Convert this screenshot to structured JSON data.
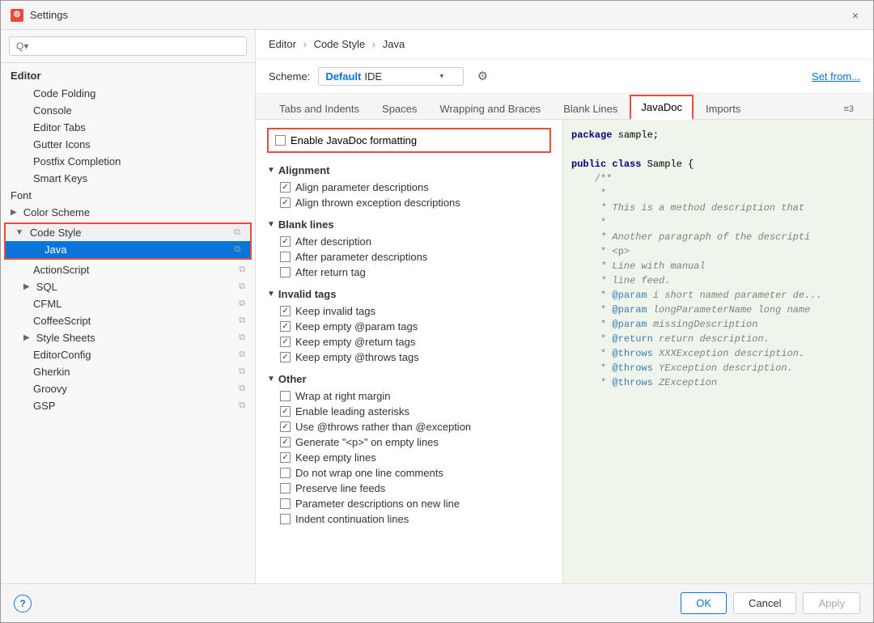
{
  "window": {
    "title": "Settings",
    "icon": "⚙",
    "close_label": "×"
  },
  "search": {
    "placeholder": "Q▾"
  },
  "sidebar": {
    "sections": [
      {
        "label": "Editor",
        "type": "section-header",
        "children": [
          {
            "label": "Code Folding",
            "indent": 1,
            "type": "item"
          },
          {
            "label": "Console",
            "indent": 1,
            "type": "item"
          },
          {
            "label": "Editor Tabs",
            "indent": 1,
            "type": "item"
          },
          {
            "label": "Gutter Icons",
            "indent": 1,
            "type": "item"
          },
          {
            "label": "Postfix Completion",
            "indent": 1,
            "type": "item"
          },
          {
            "label": "Smart Keys",
            "indent": 1,
            "type": "item"
          },
          {
            "label": "Font",
            "indent": 0,
            "type": "item"
          },
          {
            "label": "Color Scheme",
            "indent": 0,
            "type": "group-collapsed"
          },
          {
            "label": "Code Style",
            "indent": 0,
            "type": "group-expanded",
            "active": true
          },
          {
            "label": "Java",
            "indent": 1,
            "type": "item",
            "active": true
          },
          {
            "label": "ActionScript",
            "indent": 1,
            "type": "item"
          },
          {
            "label": "SQL",
            "indent": 1,
            "type": "group-collapsed"
          },
          {
            "label": "CFML",
            "indent": 1,
            "type": "item"
          },
          {
            "label": "CoffeeScript",
            "indent": 1,
            "type": "item"
          },
          {
            "label": "Style Sheets",
            "indent": 1,
            "type": "group-collapsed"
          },
          {
            "label": "EditorConfig",
            "indent": 1,
            "type": "item"
          },
          {
            "label": "Gherkin",
            "indent": 1,
            "type": "item"
          },
          {
            "label": "Groovy",
            "indent": 1,
            "type": "item"
          },
          {
            "label": "GSP",
            "indent": 1,
            "type": "item"
          }
        ]
      }
    ]
  },
  "breadcrumb": {
    "parts": [
      "Editor",
      "Code Style",
      "Java"
    ],
    "separator": "›"
  },
  "scheme": {
    "label": "Scheme:",
    "value_bold": "Default",
    "value_normal": "IDE",
    "set_from": "Set from..."
  },
  "tabs": {
    "items": [
      {
        "label": "Tabs and Indents",
        "active": false
      },
      {
        "label": "Spaces",
        "active": false
      },
      {
        "label": "Wrapping and Braces",
        "active": false
      },
      {
        "label": "Blank Lines",
        "active": false
      },
      {
        "label": "JavaDoc",
        "active": true,
        "highlighted": true
      },
      {
        "label": "Imports",
        "active": false
      }
    ],
    "more_label": "≡3"
  },
  "javadoc": {
    "enable_label": "Enable JavaDoc formatting",
    "enable_checked": false,
    "sections": [
      {
        "label": "Alignment",
        "expanded": true,
        "items": [
          {
            "label": "Align parameter descriptions",
            "checked": true
          },
          {
            "label": "Align thrown exception descriptions",
            "checked": true
          }
        ]
      },
      {
        "label": "Blank lines",
        "expanded": true,
        "items": [
          {
            "label": "After description",
            "checked": true
          },
          {
            "label": "After parameter descriptions",
            "checked": false
          },
          {
            "label": "After return tag",
            "checked": false
          }
        ]
      },
      {
        "label": "Invalid tags",
        "expanded": true,
        "items": [
          {
            "label": "Keep invalid tags",
            "checked": true
          },
          {
            "label": "Keep empty @param tags",
            "checked": true
          },
          {
            "label": "Keep empty @return tags",
            "checked": true
          },
          {
            "label": "Keep empty @throws tags",
            "checked": true
          }
        ]
      },
      {
        "label": "Other",
        "expanded": true,
        "items": [
          {
            "label": "Wrap at right margin",
            "checked": false
          },
          {
            "label": "Enable leading asterisks",
            "checked": true
          },
          {
            "label": "Use @throws rather than @exception",
            "checked": true
          },
          {
            "label": "Generate \"<p>\" on empty lines",
            "checked": true
          },
          {
            "label": "Keep empty lines",
            "checked": true
          },
          {
            "label": "Do not wrap one line comments",
            "checked": false
          },
          {
            "label": "Preserve line feeds",
            "checked": false
          },
          {
            "label": "Parameter descriptions on new line",
            "checked": false
          },
          {
            "label": "Indent continuation lines",
            "checked": false
          }
        ]
      }
    ]
  },
  "preview": {
    "lines": [
      {
        "type": "normal",
        "text": "package sample;"
      },
      {
        "type": "blank"
      },
      {
        "type": "keyword",
        "text": "public class ",
        "rest": "Sample {"
      },
      {
        "type": "comment",
        "text": "    /**"
      },
      {
        "type": "comment",
        "text": "     *"
      },
      {
        "type": "comment-italic",
        "text": "     * This is a method description that"
      },
      {
        "type": "comment",
        "text": "     *"
      },
      {
        "type": "comment-italic",
        "text": "     * Another paragraph of the descripti"
      },
      {
        "type": "comment",
        "text": "     * <p>"
      },
      {
        "type": "comment-italic",
        "text": "     * Line with manual"
      },
      {
        "type": "comment-italic",
        "text": "     * line feed."
      },
      {
        "type": "comment-tag",
        "tag": "     * @param ",
        "text": "i short named parameter de..."
      },
      {
        "type": "comment-tag",
        "tag": "     * @param ",
        "text": "longParameterName long name"
      },
      {
        "type": "comment-tag",
        "tag": "     * @param ",
        "text": "missingDescription"
      },
      {
        "type": "comment-tag",
        "tag": "     * @return ",
        "text": "return description."
      },
      {
        "type": "comment-tag",
        "tag": "     * @throws ",
        "text": "XXXException description."
      },
      {
        "type": "comment-tag",
        "tag": "     * @throws ",
        "text": "YException description."
      },
      {
        "type": "comment-tag",
        "tag": "     * @throws ",
        "text": "ZException"
      }
    ]
  },
  "footer": {
    "ok_label": "OK",
    "cancel_label": "Cancel",
    "apply_label": "Apply",
    "help_label": "?"
  }
}
